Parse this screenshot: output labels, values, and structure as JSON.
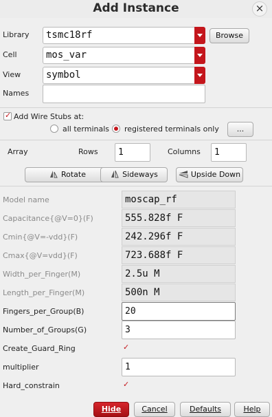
{
  "window": {
    "title": "Add Instance"
  },
  "library": {
    "label": "Library",
    "value": "tsmc18rf",
    "browse_label": "Browse"
  },
  "cell": {
    "label": "Cell",
    "value": "mos_var"
  },
  "view": {
    "label": "View",
    "value": "symbol"
  },
  "names": {
    "label": "Names",
    "value": ""
  },
  "wire_stubs": {
    "label": "Add Wire Stubs at:",
    "checked": true,
    "option_all": "all terminals",
    "option_registered": "registered terminals only",
    "selected": "registered terminals only",
    "more_label": "..."
  },
  "array": {
    "label": "Array",
    "rows_label": "Rows",
    "rows_value": "1",
    "columns_label": "Columns",
    "columns_value": "1"
  },
  "transform": {
    "rotate_label": "Rotate",
    "sideways_label": "Sideways",
    "upside_down_label": "Upside Down"
  },
  "params": [
    {
      "label": "Model name",
      "value": "moscap_rf",
      "editable": false
    },
    {
      "label": "Capacitance{@V=0}(F)",
      "value": "555.828f F",
      "editable": false
    },
    {
      "label": "Cmin{@V=-vdd}(F)",
      "value": "242.296f F",
      "editable": false
    },
    {
      "label": "Cmax{@V=vdd}(F)",
      "value": "723.688f F",
      "editable": false
    },
    {
      "label": "Width_per_Finger(M)",
      "value": "2.5u M",
      "editable": false
    },
    {
      "label": "Length_per_Finger(M)",
      "value": "500n M",
      "editable": false
    },
    {
      "label": "Fingers_per_Group(B)",
      "value": "20",
      "editable": true
    },
    {
      "label": "Number_of_Groups(G)",
      "value": "3",
      "editable": true
    },
    {
      "label": "Create_Guard_Ring",
      "checked": true
    },
    {
      "label": "multiplier",
      "value": "1",
      "editable": true
    },
    {
      "label": "Hard_constrain",
      "checked": true
    }
  ],
  "footer": {
    "hide_label": "Hide",
    "cancel_label": "Cancel",
    "defaults_label": "Defaults",
    "help_label": "Help"
  },
  "colors": {
    "accent": "#c4161c"
  }
}
